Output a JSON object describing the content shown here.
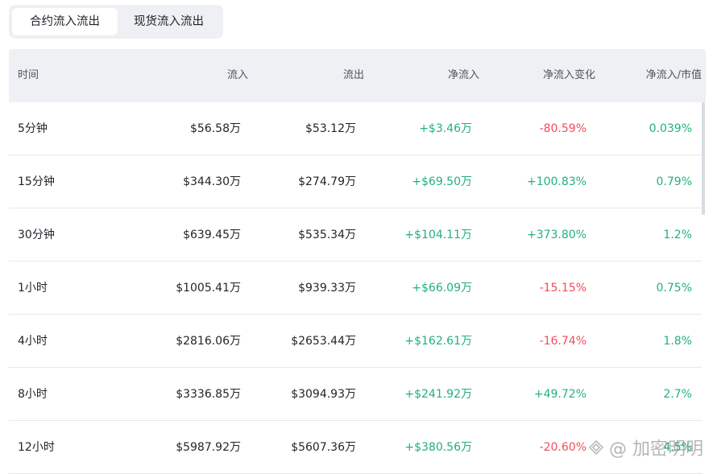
{
  "tabs": [
    {
      "label": "合约流入流出",
      "active": true
    },
    {
      "label": "现货流入流出",
      "active": false
    }
  ],
  "table": {
    "headers": [
      "时间",
      "流入",
      "流出",
      "净流入",
      "净流入变化",
      "净流入/市值"
    ],
    "rows": [
      {
        "time": "5分钟",
        "inflow": "$56.58万",
        "outflow": "$53.12万",
        "net": "+$3.46万",
        "change": "-80.59%",
        "ratio": "0.039%"
      },
      {
        "time": "15分钟",
        "inflow": "$344.30万",
        "outflow": "$274.79万",
        "net": "+$69.50万",
        "change": "+100.83%",
        "ratio": "0.79%"
      },
      {
        "time": "30分钟",
        "inflow": "$639.45万",
        "outflow": "$535.34万",
        "net": "+$104.11万",
        "change": "+373.80%",
        "ratio": "1.2%"
      },
      {
        "time": "1小时",
        "inflow": "$1005.41万",
        "outflow": "$939.33万",
        "net": "+$66.09万",
        "change": "-15.15%",
        "ratio": "0.75%"
      },
      {
        "time": "4小时",
        "inflow": "$2816.06万",
        "outflow": "$2653.44万",
        "net": "+$162.61万",
        "change": "-16.74%",
        "ratio": "1.8%"
      },
      {
        "time": "8小时",
        "inflow": "$3336.85万",
        "outflow": "$3094.93万",
        "net": "+$241.92万",
        "change": "+49.72%",
        "ratio": "2.7%"
      },
      {
        "time": "12小时",
        "inflow": "$5987.92万",
        "outflow": "$5607.36万",
        "net": "+$380.56万",
        "change": "-20.60%",
        "ratio": "4.5%"
      }
    ]
  },
  "colors": {
    "positive": "#22b07d",
    "negative": "#f04d5a",
    "header_bg": "#eef0f3"
  },
  "watermark": {
    "text": "@ 加密明明",
    "icon": "diamond-logo-icon"
  }
}
